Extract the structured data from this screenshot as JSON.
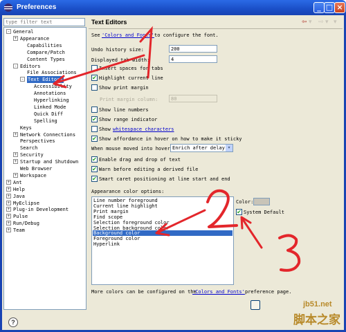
{
  "window": {
    "title": "Preferences",
    "min_glyph": "_",
    "max_glyph": "□",
    "close_glyph": "×"
  },
  "filter": {
    "placeholder": "type filter text"
  },
  "tree": [
    {
      "label": "General",
      "twisty": "-"
    },
    {
      "label": "Appearance",
      "twisty": "+"
    },
    {
      "label": "Capabilities",
      "twisty": ""
    },
    {
      "label": "Compare/Patch",
      "twisty": ""
    },
    {
      "label": "Content Types",
      "twisty": ""
    },
    {
      "label": "Editors",
      "twisty": "-"
    },
    {
      "label": "File Associations",
      "twisty": ""
    },
    {
      "label": "Text Editors",
      "twisty": "-"
    },
    {
      "label": "Accessibility",
      "twisty": ""
    },
    {
      "label": "Annotations",
      "twisty": ""
    },
    {
      "label": "Hyperlinking",
      "twisty": ""
    },
    {
      "label": "Linked Mode",
      "twisty": ""
    },
    {
      "label": "Quick Diff",
      "twisty": ""
    },
    {
      "label": "Spelling",
      "twisty": ""
    },
    {
      "label": "Keys",
      "twisty": ""
    },
    {
      "label": "Network Connections",
      "twisty": "+"
    },
    {
      "label": "Perspectives",
      "twisty": ""
    },
    {
      "label": "Search",
      "twisty": ""
    },
    {
      "label": "Security",
      "twisty": "+"
    },
    {
      "label": "Startup and Shutdown",
      "twisty": "+"
    },
    {
      "label": "Web Browser",
      "twisty": ""
    },
    {
      "label": "Workspace",
      "twisty": "+"
    },
    {
      "label": "Ant",
      "twisty": "+"
    },
    {
      "label": "Help",
      "twisty": "+"
    },
    {
      "label": "Java",
      "twisty": "+"
    },
    {
      "label": "MyEclipse",
      "twisty": "+"
    },
    {
      "label": "Plug-in Development",
      "twisty": "+"
    },
    {
      "label": "Pulse",
      "twisty": "+"
    },
    {
      "label": "Run/Debug",
      "twisty": "+"
    },
    {
      "label": "Team",
      "twisty": "+"
    }
  ],
  "page": {
    "title": "Text Editors",
    "see_prefix": "See",
    "see_link": "'Colors and Fonts'",
    "see_suffix": "to configure the font.",
    "undo_label": "Undo history size:",
    "undo_value": "200",
    "tab_label": "Displayed tab width:",
    "tab_value": "4",
    "print_margin_col_label": "Print margin column:",
    "print_margin_col_value": "80",
    "hover_label": "When mouse moved into hover:",
    "hover_value": "Enrich after delay",
    "appearance_label": "Appearance color options:",
    "color_label": "Color:",
    "system_default_label": "System Default",
    "footer_prefix": "More colors can be configured on the",
    "footer_link": "'Colors and Fonts'",
    "footer_suffix": "preference page."
  },
  "checkboxes": [
    {
      "label": "Insert spaces for tabs",
      "checked": false
    },
    {
      "label": "Highlight current line",
      "checked": true
    },
    {
      "label": "Show print margin",
      "checked": false
    },
    {
      "label": "Show line numbers",
      "checked": false
    },
    {
      "label": "Show range indicator",
      "checked": true
    },
    {
      "label": "Show",
      "link": "whitespace characters",
      "checked": false
    },
    {
      "label": "Show affordance in hover on how to make it sticky",
      "checked": true
    },
    {
      "label": "Enable drag and drop of text",
      "checked": true
    },
    {
      "label": "Warn before editing a derived file",
      "checked": true
    },
    {
      "label": "Smart caret positioning at line start and end",
      "checked": true
    }
  ],
  "checkmark": "✔",
  "color_options": [
    "Line number foreground",
    "Current line highlight",
    "Print margin",
    "Find scope",
    "Selection foreground color",
    "Selection background color",
    "Background color",
    "Foreground color",
    "Hyperlink"
  ],
  "selected_color_option": 6,
  "system_default_checked": true,
  "icons": {
    "back": "⇦",
    "forward": "⇨",
    "dropdown": "▾",
    "help": "?"
  },
  "annotations": [
    "1",
    "2",
    "3"
  ],
  "watermark": {
    "top": "jb51.net",
    "bottom": "脚本之家"
  },
  "colors": {
    "selection": "#316ac5",
    "annotation_red": "#e3262b",
    "titlebar": "#1a4fc7"
  }
}
